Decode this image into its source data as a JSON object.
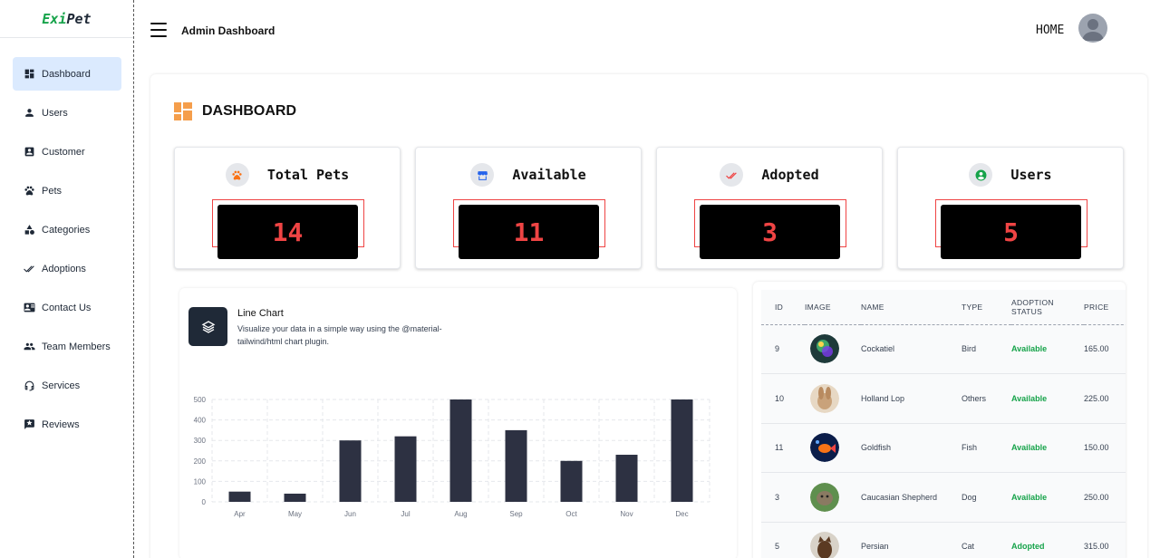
{
  "brand": {
    "part1": "Exi",
    "part2": "Pet"
  },
  "sidebar": {
    "items": [
      {
        "label": "Dashboard",
        "icon": "dashboard-icon",
        "active": true
      },
      {
        "label": "Users",
        "icon": "user-icon"
      },
      {
        "label": "Customer",
        "icon": "contact-card-icon"
      },
      {
        "label": "Pets",
        "icon": "paw-icon"
      },
      {
        "label": "Categories",
        "icon": "categories-icon"
      },
      {
        "label": "Adoptions",
        "icon": "double-check-icon"
      },
      {
        "label": "Contact Us",
        "icon": "contact-mail-icon"
      },
      {
        "label": "Team Members",
        "icon": "group-icon"
      },
      {
        "label": "Services",
        "icon": "headset-icon"
      },
      {
        "label": "Reviews",
        "icon": "review-icon"
      }
    ]
  },
  "header": {
    "title": "Admin Dashboard",
    "home": "HOME"
  },
  "page": {
    "title": "DASHBOARD"
  },
  "stats": [
    {
      "label": "Total Pets",
      "value": "14",
      "icon": "paw-icon",
      "color": "#f97316"
    },
    {
      "label": "Available",
      "value": "11",
      "icon": "store-icon",
      "color": "#2563eb"
    },
    {
      "label": "Adopted",
      "value": "3",
      "icon": "double-check-icon",
      "color": "#ef4444"
    },
    {
      "label": "Users",
      "value": "5",
      "icon": "user-circle-icon",
      "color": "#16a34a"
    }
  ],
  "chart": {
    "title": "Line Chart",
    "subtitle": "Visualize your data in a simple way using the @material-tailwind/html chart plugin."
  },
  "chart_data": {
    "type": "bar",
    "categories": [
      "Apr",
      "May",
      "Jun",
      "Jul",
      "Aug",
      "Sep",
      "Oct",
      "Nov",
      "Dec"
    ],
    "values": [
      50,
      40,
      300,
      320,
      500,
      350,
      200,
      230,
      500
    ],
    "yticks": [
      0,
      100,
      200,
      300,
      400,
      500
    ],
    "ylim": [
      0,
      500
    ],
    "grid": true,
    "bar_color": "#2d3142"
  },
  "table": {
    "headers": [
      "ID",
      "IMAGE",
      "NAME",
      "TYPE",
      "ADOPTION STATUS",
      "PRICE"
    ],
    "rows": [
      {
        "id": "9",
        "name": "Cockatiel",
        "type": "Bird",
        "status": "Available",
        "price": "165.00"
      },
      {
        "id": "10",
        "name": "Holland Lop",
        "type": "Others",
        "status": "Available",
        "price": "225.00"
      },
      {
        "id": "11",
        "name": "Goldfish",
        "type": "Fish",
        "status": "Available",
        "price": "150.00"
      },
      {
        "id": "3",
        "name": "Caucasian Shepherd",
        "type": "Dog",
        "status": "Available",
        "price": "250.00"
      },
      {
        "id": "5",
        "name": "Persian",
        "type": "Cat",
        "status": "Adopted",
        "price": "315.00"
      }
    ]
  }
}
